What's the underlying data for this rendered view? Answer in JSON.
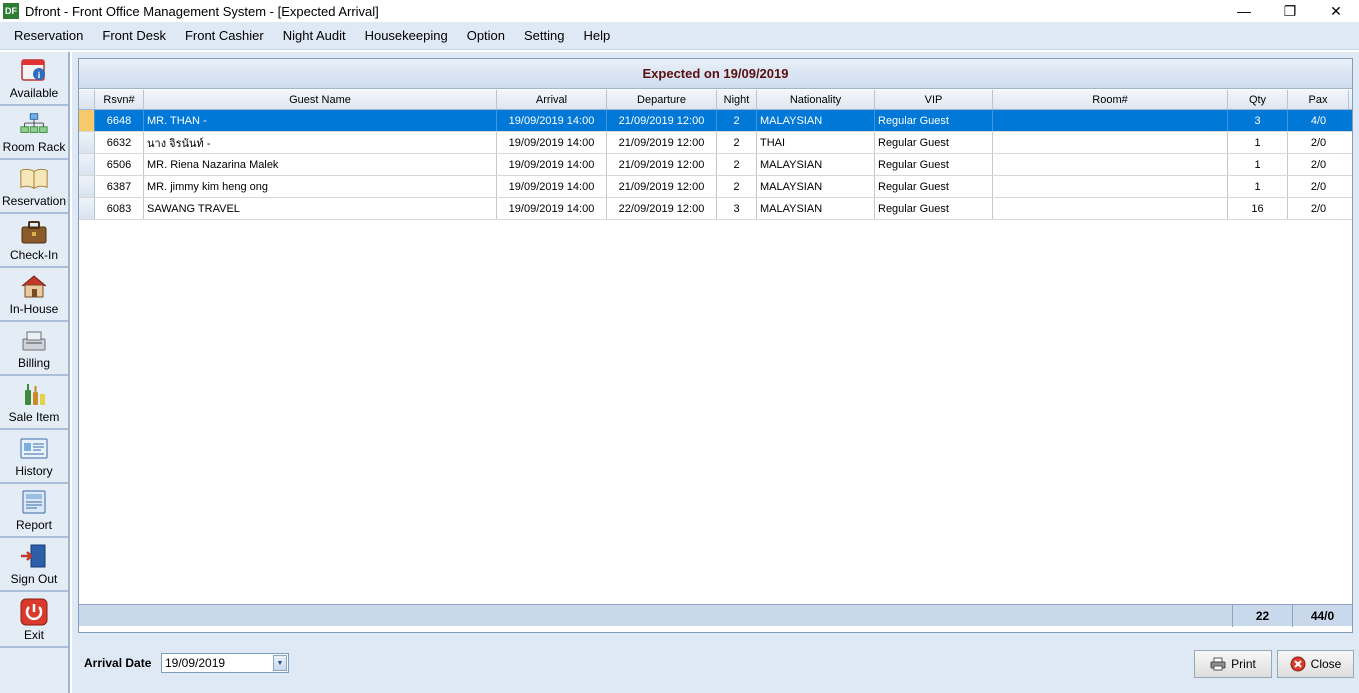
{
  "window": {
    "icon_text": "DF",
    "title": "Dfront - Front Office Management System - [Expected Arrival]",
    "minimize": "—",
    "restore": "❐",
    "close": "✕"
  },
  "menu": [
    "Reservation",
    "Front Desk",
    "Front Cashier",
    "Night Audit",
    "Housekeeping",
    "Option",
    "Setting",
    "Help"
  ],
  "sidebar": [
    {
      "label": "Available",
      "icon": "calendar-info-icon"
    },
    {
      "label": "Room Rack",
      "icon": "room-rack-icon"
    },
    {
      "label": "Reservation",
      "icon": "book-icon"
    },
    {
      "label": "Check-In",
      "icon": "briefcase-icon"
    },
    {
      "label": "In-House",
      "icon": "house-icon"
    },
    {
      "label": "Billing",
      "icon": "cash-register-icon"
    },
    {
      "label": "Sale Item",
      "icon": "bottles-icon"
    },
    {
      "label": "History",
      "icon": "history-card-icon"
    },
    {
      "label": "Report",
      "icon": "report-icon"
    },
    {
      "label": "Sign Out",
      "icon": "door-icon"
    },
    {
      "label": "Exit",
      "icon": "power-icon"
    }
  ],
  "panel": {
    "heading": "Expected on 19/09/2019"
  },
  "table": {
    "columns": [
      "Rsvn#",
      "Guest Name",
      "Arrival",
      "Departure",
      "Night",
      "Nationality",
      "VIP",
      "Room#",
      "Qty",
      "Pax"
    ],
    "rows": [
      {
        "rsvn": "6648",
        "name": "MR. THAN -",
        "arrival": "19/09/2019 14:00",
        "departure": "21/09/2019 12:00",
        "night": "2",
        "nationality": "MALAYSIAN",
        "vip": "Regular Guest",
        "room": "",
        "qty": "3",
        "pax": "4/0"
      },
      {
        "rsvn": "6632",
        "name": "นาง จิรนันท์ -",
        "arrival": "19/09/2019 14:00",
        "departure": "21/09/2019 12:00",
        "night": "2",
        "nationality": "THAI",
        "vip": "Regular Guest",
        "room": "",
        "qty": "1",
        "pax": "2/0"
      },
      {
        "rsvn": "6506",
        "name": "MR. Riena Nazarina Malek",
        "arrival": "19/09/2019 14:00",
        "departure": "21/09/2019 12:00",
        "night": "2",
        "nationality": "MALAYSIAN",
        "vip": "Regular Guest",
        "room": "",
        "qty": "1",
        "pax": "2/0"
      },
      {
        "rsvn": "6387",
        "name": "MR. jimmy kim heng ong",
        "arrival": "19/09/2019 14:00",
        "departure": "21/09/2019 12:00",
        "night": "2",
        "nationality": "MALAYSIAN",
        "vip": "Regular Guest",
        "room": "",
        "qty": "1",
        "pax": "2/0"
      },
      {
        "rsvn": "6083",
        "name": "SAWANG TRAVEL",
        "arrival": "19/09/2019 14:00",
        "departure": "22/09/2019 12:00",
        "night": "3",
        "nationality": "MALAYSIAN",
        "vip": "Regular Guest",
        "room": "",
        "qty": "16",
        "pax": "2/0"
      }
    ],
    "selected_index": 0,
    "totals": {
      "qty": "22",
      "pax": "44/0"
    }
  },
  "footer": {
    "arrival_date_label": "Arrival Date",
    "arrival_date_value": "19/09/2019",
    "print_label": "Print",
    "close_label": "Close"
  },
  "colors": {
    "selection": "#0078d7",
    "heading_text": "#5a1010",
    "panel_bg": "#dfe9f5"
  }
}
